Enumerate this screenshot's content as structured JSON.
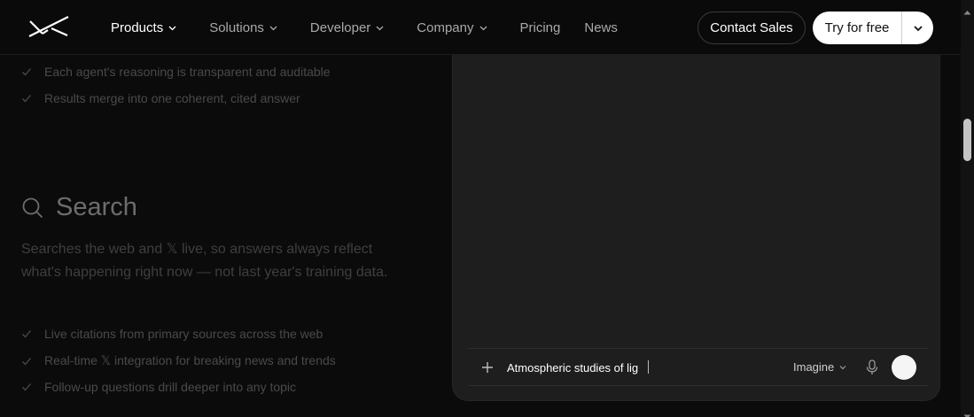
{
  "nav": {
    "items": [
      {
        "label": "Products",
        "has_menu": true,
        "active": true
      },
      {
        "label": "Solutions",
        "has_menu": true,
        "active": false
      },
      {
        "label": "Developer",
        "has_menu": true,
        "active": false
      },
      {
        "label": "Company",
        "has_menu": true,
        "active": false
      },
      {
        "label": "Pricing",
        "has_menu": false,
        "active": false
      },
      {
        "label": "News",
        "has_menu": false,
        "active": false
      }
    ],
    "contact_label": "Contact Sales",
    "try_label": "Try for free"
  },
  "agents_section": {
    "checks": [
      "Each agent's reasoning is transparent and auditable",
      "Results merge into one coherent, cited answer"
    ]
  },
  "search_section": {
    "title": "Search",
    "description": "Searches the web and 𝕏 live, so answers always reflect what's happening right now — not last year's training data.",
    "checks": [
      "Live citations from primary sources across the web",
      "Real-time 𝕏 integration for breaking news and trends",
      "Follow-up questions drill deeper into any topic"
    ]
  },
  "composer": {
    "input_value": "Atmospheric studies of lig",
    "mode_label": "Imagine"
  },
  "colors": {
    "background": "#0b0b0b",
    "panel": "#1e1e1e",
    "accent_button": "#ffffff"
  }
}
